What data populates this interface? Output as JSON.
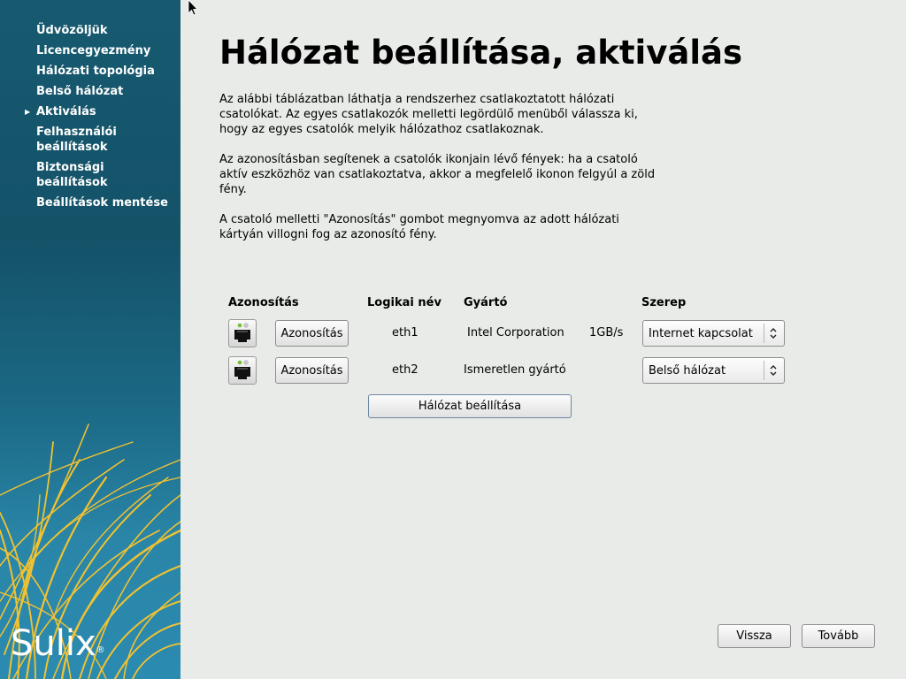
{
  "sidebar": {
    "items": [
      {
        "label": "Üdvözöljük",
        "active": false
      },
      {
        "label": "Licencegyezmény",
        "active": false
      },
      {
        "label": "Hálózati topológia",
        "active": false
      },
      {
        "label": "Belső hálózat",
        "active": false
      },
      {
        "label": "Aktiválás",
        "active": true
      },
      {
        "label": "Felhasználói beállítások",
        "active": false
      },
      {
        "label": "Biztonsági beállítások",
        "active": false
      },
      {
        "label": "Beállítások mentése",
        "active": false
      }
    ],
    "logo_text": "Sulix",
    "logo_mark": "®"
  },
  "page": {
    "title": "Hálózat beállítása, aktiválás",
    "paragraphs": [
      "Az alábbi táblázatban láthatja a rendszerhez csatlakoztatott hálózati csatolókat. Az egyes csatlakozók melletti legördülő menüből válassza ki, hogy az egyes csatolók melyik hálózathoz csatlakoznak.",
      "Az azonosításban segítenek a csatolók ikonjain lévő fények: ha a csatoló aktív eszközhöz van csatlakoztatva, akkor a megfelelő ikonon felgyúl a zöld fény.",
      "A csatoló melletti \"Azonosítás\" gombot megnyomva az adott hálózati kártyán villogni fog az azonosító fény."
    ]
  },
  "table": {
    "headers": {
      "identify": "Azonosítás",
      "logical_name": "Logikai név",
      "vendor": "Gyártó",
      "role": "Szerep"
    },
    "rows": [
      {
        "identify_button": "Azonosítás",
        "name": "eth1",
        "vendor": "Intel Corporation",
        "speed": "1GB/s",
        "role": "Internet kapcsolat",
        "icon": "network-port-icon",
        "led": "#6fbf3a"
      },
      {
        "identify_button": "Azonosítás",
        "name": "eth2",
        "vendor": "Ismeretlen gyártó",
        "speed": "",
        "role": "Belső hálózat",
        "icon": "network-port-icon",
        "led": "#6fbf3a"
      }
    ],
    "configure_button": "Hálózat beállítása"
  },
  "footer": {
    "back_label": "Vissza",
    "next_label": "Tovább"
  },
  "colors": {
    "sidebar_bg": "#175a70",
    "content_bg": "#e8ebe7",
    "grass": "#f2c230",
    "led_green": "#6fbf3a"
  }
}
